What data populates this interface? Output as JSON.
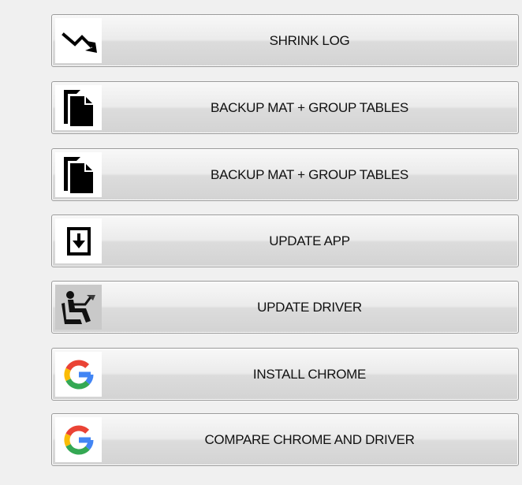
{
  "buttons": [
    {
      "label": "SHRINK LOG",
      "icon": "trend-down-icon"
    },
    {
      "label": "BACKUP MAT + GROUP TABLES",
      "icon": "copy-icon"
    },
    {
      "label": "BACKUP MAT + GROUP TABLES",
      "icon": "copy-icon"
    },
    {
      "label": "UPDATE APP",
      "icon": "download-icon"
    },
    {
      "label": "UPDATE DRIVER",
      "icon": "driver-icon"
    },
    {
      "label": "INSTALL CHROME",
      "icon": "google-icon"
    },
    {
      "label": "COMPARE CHROME AND DRIVER",
      "icon": "google-icon"
    }
  ],
  "colors": {
    "background": "#f0f0f0",
    "button_border": "#9a9a9a",
    "google_blue": "#4285F4",
    "google_red": "#EA4335",
    "google_yellow": "#FBBC05",
    "google_green": "#34A853"
  }
}
